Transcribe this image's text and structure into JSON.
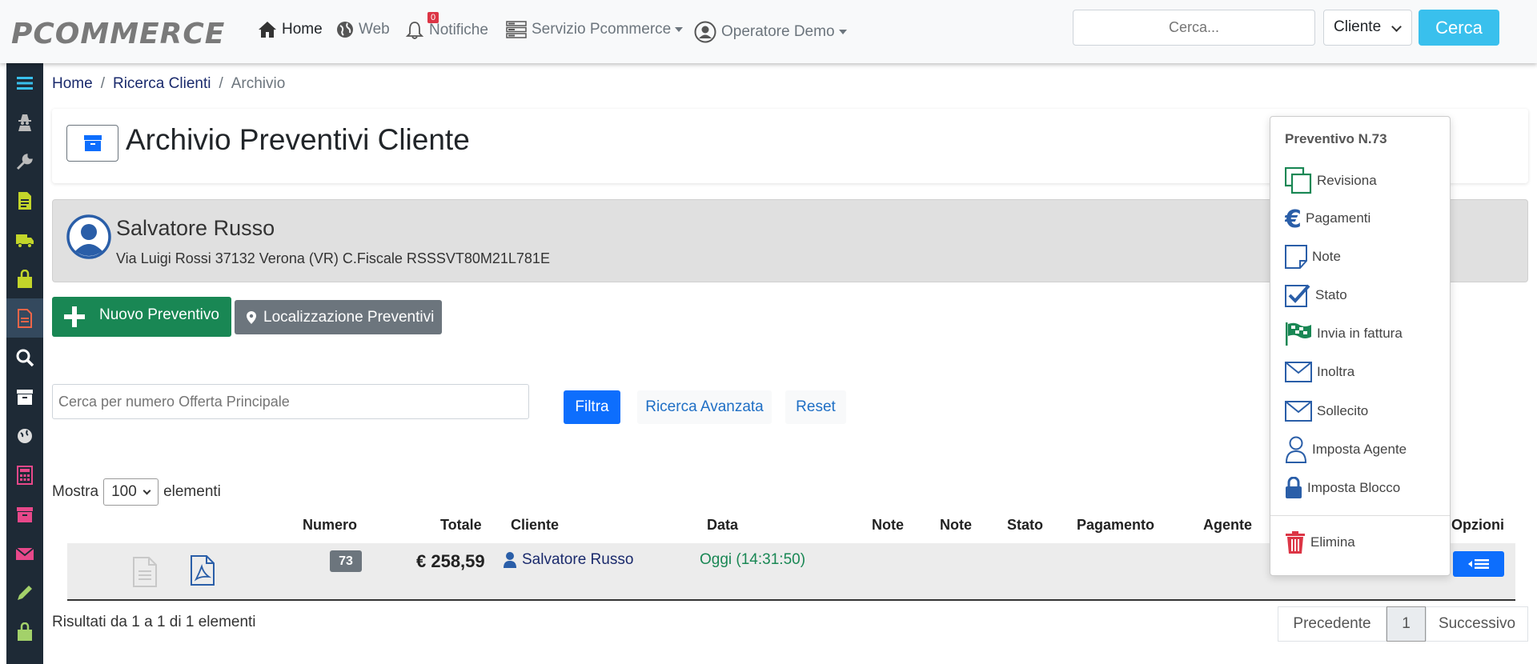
{
  "brand": "PCOMMERCE",
  "nav": {
    "home": "Home",
    "web": "Web",
    "notifiche": "Notifiche",
    "notifiche_count": "0",
    "servizio": "Servizio Pcommerce",
    "operatore": "Operatore Demo"
  },
  "top_search": {
    "placeholder": "Cerca...",
    "select_value": "Cliente",
    "button": "Cerca"
  },
  "breadcrumb": {
    "home": "Home",
    "ricerca": "Ricerca Clienti",
    "current": "Archivio"
  },
  "page_title": "Archivio Preventivi Cliente",
  "client": {
    "name": "Salvatore Russo",
    "address": "Via Luigi Rossi 37132 Verona (VR) C.Fiscale RSSSVT80M21L781E"
  },
  "actions": {
    "nuovo": "Nuovo Preventivo",
    "localizzazione": "Localizzazione Preventivi"
  },
  "filter": {
    "placeholder": "Cerca per numero Offerta Principale",
    "filtra": "Filtra",
    "avanzata": "Ricerca Avanzata",
    "reset": "Reset"
  },
  "show": {
    "prefix": "Mostra",
    "value": "100",
    "suffix": "elementi"
  },
  "table": {
    "headers": {
      "numero": "Numero",
      "totale": "Totale",
      "cliente": "Cliente",
      "data": "Data",
      "note1": "Note",
      "note2": "Note",
      "stato": "Stato",
      "pagamento": "Pagamento",
      "agente": "Agente",
      "opzioni": "Opzioni"
    },
    "rows": [
      {
        "numero": "73",
        "totale": "€ 258,59",
        "cliente": "Salvatore Russo",
        "data": "Oggi (14:31:50)"
      }
    ]
  },
  "results": "Risultati da 1 a 1 di 1 elementi",
  "pager": {
    "prev": "Precedente",
    "page": "1",
    "next": "Successivo"
  },
  "dropdown": {
    "header": "Preventivo N.73",
    "items": [
      "Revisiona",
      "Pagamenti",
      "Note",
      "Stato",
      "Invia in fattura",
      "Inoltra",
      "Sollecito",
      "Imposta Agente",
      "Imposta Blocco"
    ],
    "delete": "Elimina"
  },
  "colors": {
    "primary": "#0d6efd",
    "success": "#198754",
    "info": "#39c0ed",
    "secondary": "#6c757d",
    "danger": "#dc3545",
    "sidebar": "#1e2a36"
  }
}
